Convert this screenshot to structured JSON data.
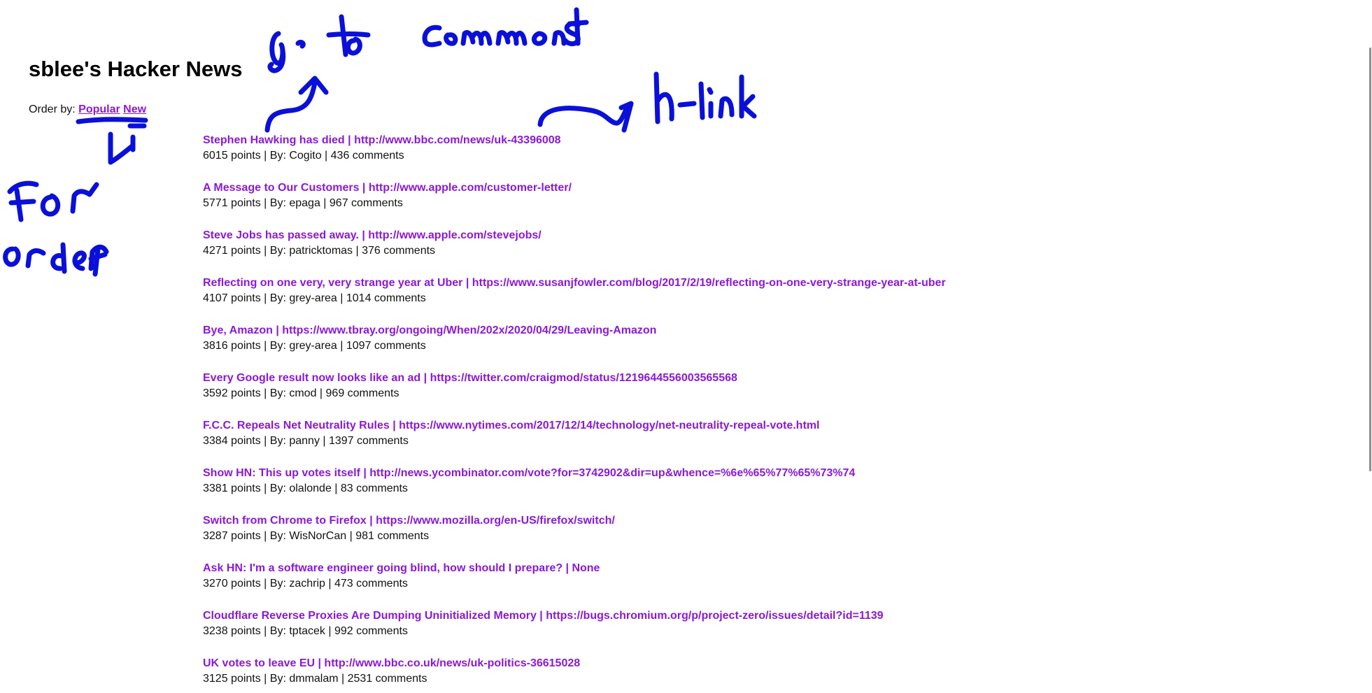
{
  "page_title": "sblee's Hacker News",
  "order": {
    "label": "Order by:",
    "options": [
      "Popular",
      "New"
    ]
  },
  "stories": [
    {
      "title": "Stephen Hawking has died",
      "url": "http://www.bbc.com/news/uk-43396008",
      "points": "6015",
      "author": "Cogito",
      "comments": "436"
    },
    {
      "title": "A Message to Our Customers",
      "url": "http://www.apple.com/customer-letter/",
      "points": "5771",
      "author": "epaga",
      "comments": "967"
    },
    {
      "title": "Steve Jobs has passed away.",
      "url": "http://www.apple.com/stevejobs/",
      "points": "4271",
      "author": "patricktomas",
      "comments": "376"
    },
    {
      "title": "Reflecting on one very, very strange year at Uber",
      "url": "https://www.susanjfowler.com/blog/2017/2/19/reflecting-on-one-very-strange-year-at-uber",
      "points": "4107",
      "author": "grey-area",
      "comments": "1014"
    },
    {
      "title": "Bye, Amazon",
      "url": "https://www.tbray.org/ongoing/When/202x/2020/04/29/Leaving-Amazon",
      "points": "3816",
      "author": "grey-area",
      "comments": "1097"
    },
    {
      "title": "Every Google result now looks like an ad",
      "url": "https://twitter.com/craigmod/status/1219644556003565568",
      "points": "3592",
      "author": "cmod",
      "comments": "969"
    },
    {
      "title": "F.C.C. Repeals Net Neutrality Rules",
      "url": "https://www.nytimes.com/2017/12/14/technology/net-neutrality-repeal-vote.html",
      "points": "3384",
      "author": "panny",
      "comments": "1397"
    },
    {
      "title": "Show HN: This up votes itself",
      "url": "http://news.ycombinator.com/vote?for=3742902&dir=up&whence=%6e%65%77%65%73%74",
      "points": "3381",
      "author": "olalonde",
      "comments": "83"
    },
    {
      "title": "Switch from Chrome to Firefox",
      "url": "https://www.mozilla.org/en-US/firefox/switch/",
      "points": "3287",
      "author": "WisNorCan",
      "comments": "981"
    },
    {
      "title": "Ask HN: I'm a software engineer going blind, how should I prepare?",
      "url": "None",
      "points": "3270",
      "author": "zachrip",
      "comments": "473"
    },
    {
      "title": "Cloudflare Reverse Proxies Are Dumping Uninitialized Memory",
      "url": "https://bugs.chromium.org/p/project-zero/issues/detail?id=1139",
      "points": "3238",
      "author": "tptacek",
      "comments": "992"
    },
    {
      "title": "UK votes to leave EU",
      "url": "http://www.bbc.co.uk/news/uk-politics-36615028",
      "points": "3125",
      "author": "dmmalam",
      "comments": "2531"
    }
  ],
  "labels": {
    "separator": " | ",
    "points_suffix": " points",
    "by_prefix": "By: ",
    "comments_suffix": " comments"
  },
  "annotations": {
    "color": "#0a10d8",
    "notes": [
      "go to comments",
      "h-link",
      "for order"
    ]
  },
  "colors": {
    "link": "#8a19d6",
    "text": "#111111",
    "background": "#ffffff"
  }
}
